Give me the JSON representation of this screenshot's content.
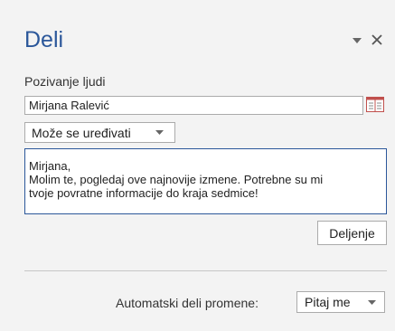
{
  "pane": {
    "title": "Deli",
    "options_icon": "chevron-down-icon",
    "close_icon": "close-icon"
  },
  "invite": {
    "label": "Pozivanje ljudi",
    "names_value": "Mirjana Ralević",
    "address_book_icon": "address-book-icon"
  },
  "permission": {
    "selected": "Može se uređivati"
  },
  "message": {
    "lines": [
      "Mirjana,",
      "Molim te, pogledaj ove najnovije izmene. Potrebne su mi",
      "tvoje povratne informacije do kraja sedmice!"
    ]
  },
  "share_button": {
    "label": "Deljenje"
  },
  "auto_share": {
    "label": "Automatski deli promene:",
    "selected": "Pitaj me"
  },
  "colors": {
    "accent": "#2b579a",
    "background": "#f3f3f3",
    "border": "#ababab"
  }
}
